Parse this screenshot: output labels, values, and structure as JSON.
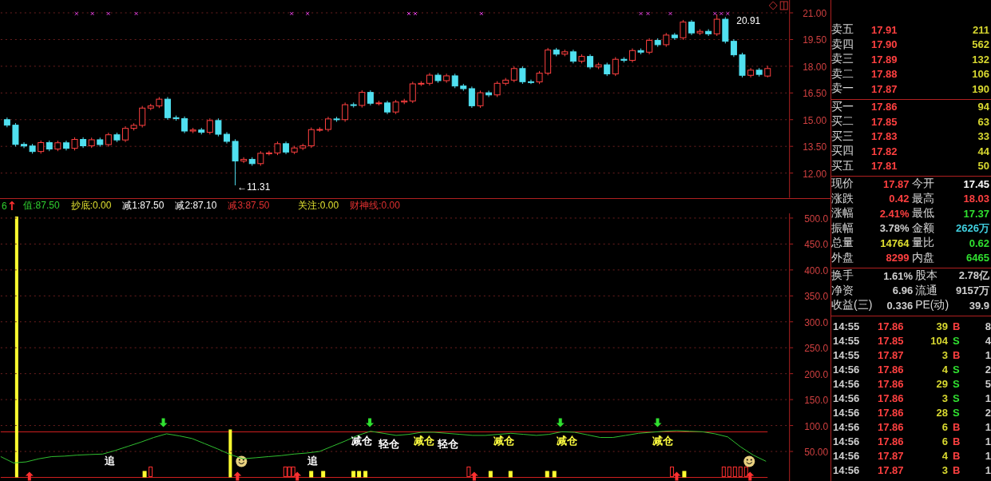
{
  "price_chart": {
    "high_label": "20.91",
    "low_label": "←11.31",
    "chart_data": {
      "type": "candlestick",
      "grid": true,
      "ylim": [
        10.61,
        21.72
      ],
      "yticks": [
        {
          "value": 21,
          "label": "21.00"
        },
        {
          "value": 19.5,
          "label": "19.50"
        },
        {
          "value": 18,
          "label": "18.00"
        },
        {
          "value": 16.5,
          "label": "16.50"
        },
        {
          "value": 15,
          "label": "15.00"
        },
        {
          "value": 13.5,
          "label": "13.50"
        },
        {
          "value": 12,
          "label": "12.00"
        }
      ],
      "ohlc": [
        [
          15.0,
          15.12,
          14.57,
          14.69
        ],
        [
          14.69,
          14.81,
          13.49,
          13.61
        ],
        [
          13.61,
          13.73,
          13.4,
          13.52
        ],
        [
          13.52,
          13.64,
          13.09,
          13.21
        ],
        [
          13.21,
          13.83,
          13.09,
          13.71
        ],
        [
          13.71,
          13.83,
          13.23,
          13.35
        ],
        [
          13.35,
          13.82,
          13.23,
          13.7
        ],
        [
          13.7,
          13.82,
          13.27,
          13.39
        ],
        [
          13.39,
          14.01,
          13.27,
          13.89
        ],
        [
          13.89,
          14.01,
          13.41,
          13.53
        ],
        [
          13.53,
          13.99,
          13.41,
          13.87
        ],
        [
          13.87,
          13.99,
          13.48,
          13.6
        ],
        [
          13.6,
          14.27,
          13.48,
          14.15
        ],
        [
          14.15,
          14.27,
          13.74,
          13.86
        ],
        [
          13.86,
          14.63,
          13.74,
          14.51
        ],
        [
          14.51,
          14.8,
          14.39,
          14.68
        ],
        [
          14.68,
          15.77,
          14.56,
          15.65
        ],
        [
          15.65,
          15.89,
          15.53,
          15.77
        ],
        [
          15.77,
          16.27,
          15.65,
          16.15
        ],
        [
          16.15,
          16.27,
          14.99,
          15.11
        ],
        [
          15.11,
          15.23,
          14.94,
          15.06
        ],
        [
          15.06,
          15.18,
          14.24,
          14.36
        ],
        [
          14.36,
          14.54,
          14.24,
          14.42
        ],
        [
          14.42,
          14.54,
          14.17,
          14.29
        ],
        [
          14.29,
          15.07,
          14.17,
          14.95
        ],
        [
          14.95,
          15.07,
          14.06,
          14.18
        ],
        [
          14.18,
          14.3,
          13.66,
          13.78
        ],
        [
          13.78,
          13.9,
          11.31,
          12.68
        ],
        [
          12.68,
          12.89,
          12.56,
          12.77
        ],
        [
          12.77,
          12.89,
          12.41,
          12.53
        ],
        [
          12.53,
          13.23,
          12.41,
          13.11
        ],
        [
          13.11,
          13.25,
          12.99,
          13.13
        ],
        [
          13.13,
          13.77,
          13.01,
          13.65
        ],
        [
          13.65,
          13.77,
          13.06,
          13.18
        ],
        [
          13.18,
          13.53,
          13.06,
          13.41
        ],
        [
          13.41,
          13.65,
          13.29,
          13.53
        ],
        [
          13.53,
          14.56,
          13.41,
          14.44
        ],
        [
          14.44,
          14.57,
          14.32,
          14.45
        ],
        [
          14.45,
          15.16,
          14.33,
          15.04
        ],
        [
          15.04,
          15.16,
          14.88,
          15.0
        ],
        [
          15.0,
          15.96,
          14.88,
          15.84
        ],
        [
          15.84,
          15.96,
          15.68,
          15.8
        ],
        [
          15.8,
          16.65,
          15.68,
          16.53
        ],
        [
          16.53,
          16.65,
          15.8,
          15.92
        ],
        [
          15.92,
          16.06,
          15.8,
          15.94
        ],
        [
          15.94,
          16.06,
          15.31,
          15.43
        ],
        [
          15.43,
          16.11,
          15.31,
          15.99
        ],
        [
          15.99,
          16.17,
          15.87,
          16.05
        ],
        [
          16.05,
          17.13,
          15.93,
          17.01
        ],
        [
          17.01,
          17.16,
          16.89,
          17.04
        ],
        [
          17.04,
          17.62,
          16.92,
          17.5
        ],
        [
          17.5,
          17.62,
          17.07,
          17.19
        ],
        [
          17.19,
          17.58,
          17.07,
          17.46
        ],
        [
          17.46,
          17.58,
          16.77,
          16.89
        ],
        [
          16.89,
          17.01,
          16.62,
          16.74
        ],
        [
          16.74,
          16.86,
          15.66,
          15.78
        ],
        [
          15.78,
          16.63,
          15.66,
          16.51
        ],
        [
          16.51,
          16.63,
          16.27,
          16.39
        ],
        [
          16.39,
          17.16,
          16.27,
          17.04
        ],
        [
          17.04,
          17.34,
          16.92,
          17.22
        ],
        [
          17.22,
          17.99,
          17.1,
          17.87
        ],
        [
          17.87,
          17.99,
          17.01,
          17.13
        ],
        [
          17.13,
          17.25,
          17.0,
          17.12
        ],
        [
          17.12,
          17.73,
          17.0,
          17.61
        ],
        [
          17.61,
          19.03,
          17.49,
          18.91
        ],
        [
          18.91,
          19.03,
          18.56,
          18.68
        ],
        [
          18.68,
          18.93,
          18.56,
          18.81
        ],
        [
          18.81,
          18.93,
          18.16,
          18.28
        ],
        [
          18.28,
          18.67,
          18.16,
          18.55
        ],
        [
          18.55,
          18.67,
          17.84,
          17.96
        ],
        [
          17.96,
          18.2,
          17.84,
          18.08
        ],
        [
          18.08,
          18.2,
          17.45,
          17.57
        ],
        [
          17.57,
          18.51,
          17.45,
          18.39
        ],
        [
          18.39,
          18.51,
          18.21,
          18.33
        ],
        [
          18.33,
          19.0,
          18.21,
          18.88
        ],
        [
          18.88,
          19.0,
          18.67,
          18.79
        ],
        [
          18.79,
          19.57,
          18.67,
          19.45
        ],
        [
          19.45,
          19.57,
          19.09,
          19.21
        ],
        [
          19.21,
          19.87,
          19.09,
          19.75
        ],
        [
          19.75,
          19.87,
          19.48,
          19.6
        ],
        [
          19.6,
          20.6,
          19.48,
          20.48
        ],
        [
          20.48,
          20.6,
          19.75,
          19.87
        ],
        [
          19.87,
          20.08,
          19.75,
          19.96
        ],
        [
          19.96,
          20.08,
          19.7,
          19.82
        ],
        [
          19.82,
          20.91,
          19.7,
          20.64
        ],
        [
          20.64,
          20.76,
          19.28,
          19.4
        ],
        [
          19.4,
          19.52,
          18.52,
          18.64
        ],
        [
          18.64,
          18.76,
          17.37,
          17.49
        ],
        [
          17.49,
          17.9,
          17.37,
          17.78
        ],
        [
          17.78,
          17.9,
          17.42,
          17.54
        ],
        [
          17.45,
          18.03,
          17.37,
          17.87
        ]
      ]
    }
  },
  "indicator": {
    "legend": [
      {
        "text": "6",
        "color": "#30d030"
      },
      {
        "text": "↑",
        "color": "#ff3030"
      },
      {
        "text": "值:87.50",
        "color": "#30d030"
      },
      {
        "text": "抄底:0.00",
        "color": "#e0e030"
      },
      {
        "text": "减1:87.50",
        "color": "#ffffff"
      },
      {
        "text": "减2:87.10",
        "color": "#ffffff"
      },
      {
        "text": "减3:87.50",
        "color": "#e03030"
      },
      {
        "text": "关注:0.00",
        "color": "#e0e030"
      },
      {
        "text": "财神线:0.00",
        "color": "#e03030"
      }
    ],
    "chart_data": {
      "type": "line",
      "grid": true,
      "ylim": [
        -7.6,
        503
      ],
      "yticks": [
        {
          "value": 500,
          "label": "500.0"
        },
        {
          "value": 450,
          "label": "450.0"
        },
        {
          "value": 400,
          "label": "400.0"
        },
        {
          "value": 350,
          "label": "350.0"
        },
        {
          "value": 300,
          "label": "300.0"
        },
        {
          "value": 250,
          "label": "250.0"
        },
        {
          "value": 200,
          "label": "200.0"
        },
        {
          "value": 150,
          "label": "150.0"
        },
        {
          "value": 100,
          "label": "100.0"
        },
        {
          "value": 50,
          "label": "50.00"
        }
      ],
      "series": [
        {
          "color": "#30c030",
          "values": [
            40,
            28,
            30,
            36,
            40,
            41,
            43,
            44,
            45,
            52,
            60,
            68,
            77,
            84,
            80,
            75,
            65,
            55,
            44,
            36,
            38,
            40,
            42,
            45,
            47,
            50,
            60,
            70,
            81,
            89,
            85,
            81,
            83,
            87,
            87,
            85,
            83,
            81,
            81,
            83,
            85,
            83,
            81,
            83,
            88,
            87,
            82,
            77,
            77,
            81,
            85,
            87,
            89,
            90,
            89,
            88,
            84,
            78,
            59,
            43,
            31
          ]
        }
      ]
    },
    "annotations": [
      {
        "text": "追",
        "color": "#ffffff"
      },
      {
        "text": "追",
        "color": "#ffffff"
      },
      {
        "text": "减仓",
        "color": "#ffffff"
      },
      {
        "text": "轻仓",
        "color": "#ffffff"
      },
      {
        "text": "减仓",
        "color": "#ffff40"
      },
      {
        "text": "轻仓",
        "color": "#ffffff"
      },
      {
        "text": "减仓",
        "color": "#ffff40"
      },
      {
        "text": "减仓",
        "color": "#ffff40"
      },
      {
        "text": "减仓",
        "color": "#ffff40"
      }
    ]
  },
  "order_book": {
    "asks": [
      {
        "label": "卖五",
        "price": "17.91",
        "volume": "211"
      },
      {
        "label": "卖四",
        "price": "17.90",
        "volume": "562"
      },
      {
        "label": "卖三",
        "price": "17.89",
        "volume": "132"
      },
      {
        "label": "卖二",
        "price": "17.88",
        "volume": "106"
      },
      {
        "label": "卖一",
        "price": "17.87",
        "volume": "190"
      }
    ],
    "bids": [
      {
        "label": "买一",
        "price": "17.86",
        "volume": "94"
      },
      {
        "label": "买二",
        "price": "17.85",
        "volume": "63"
      },
      {
        "label": "买三",
        "price": "17.83",
        "volume": "33"
      },
      {
        "label": "买四",
        "price": "17.82",
        "volume": "44"
      },
      {
        "label": "买五",
        "price": "17.81",
        "volume": "50"
      }
    ]
  },
  "quote": [
    {
      "label": "现价",
      "value": "17.87",
      "color": "#ff4040"
    },
    {
      "label": "今开",
      "value": "17.45",
      "color": "#ffffff"
    },
    {
      "label": "涨跌",
      "value": "0.42",
      "color": "#ff4040"
    },
    {
      "label": "最高",
      "value": "18.03",
      "color": "#ff4040"
    },
    {
      "label": "涨幅",
      "value": "2.41%",
      "color": "#ff4040"
    },
    {
      "label": "最低",
      "value": "17.37",
      "color": "#30e030"
    },
    {
      "label": "振幅",
      "value": "3.78%",
      "color": "#d0d0d0"
    },
    {
      "label": "金额",
      "value": "2626万",
      "color": "#40d0e0"
    },
    {
      "label": "总量",
      "value": "14764",
      "color": "#e0e030"
    },
    {
      "label": "量比",
      "value": "0.62",
      "color": "#30e030"
    },
    {
      "label": "外盘",
      "value": "8299",
      "color": "#ff4040"
    },
    {
      "label": "内盘",
      "value": "6465",
      "color": "#30e030"
    }
  ],
  "fundamentals": [
    {
      "label": "换手",
      "value": "1.61%"
    },
    {
      "label": "股本",
      "value": "2.78亿"
    },
    {
      "label": "净资",
      "value": "6.96"
    },
    {
      "label": "流通",
      "value": "9157万"
    },
    {
      "label": "收益(三)",
      "value": "0.336"
    },
    {
      "label": "PE(动)",
      "value": "39.9"
    }
  ],
  "trades": [
    {
      "time": "14:55",
      "price": "17.86",
      "volume": "39",
      "side": "B",
      "kind": "buy",
      "count": "8"
    },
    {
      "time": "14:55",
      "price": "17.85",
      "volume": "104",
      "side": "S",
      "kind": "sell",
      "count": "4"
    },
    {
      "time": "14:55",
      "price": "17.87",
      "volume": "3",
      "side": "B",
      "kind": "buy",
      "count": "1"
    },
    {
      "time": "14:56",
      "price": "17.86",
      "volume": "4",
      "side": "S",
      "kind": "sell",
      "count": "2"
    },
    {
      "time": "14:56",
      "price": "17.86",
      "volume": "29",
      "side": "S",
      "kind": "sell",
      "count": "5"
    },
    {
      "time": "14:56",
      "price": "17.86",
      "volume": "3",
      "side": "S",
      "kind": "sell",
      "count": "1"
    },
    {
      "time": "14:56",
      "price": "17.86",
      "volume": "28",
      "side": "S",
      "kind": "sell",
      "count": "2"
    },
    {
      "time": "14:56",
      "price": "17.86",
      "volume": "6",
      "side": "B",
      "kind": "buy",
      "count": "1"
    },
    {
      "time": "14:56",
      "price": "17.86",
      "volume": "6",
      "side": "B",
      "kind": "buy",
      "count": "1"
    },
    {
      "time": "14:56",
      "price": "17.87",
      "volume": "4",
      "side": "B",
      "kind": "buy",
      "count": "1"
    },
    {
      "time": "14:56",
      "price": "17.87",
      "volume": "3",
      "side": "B",
      "kind": "buy",
      "count": "1"
    }
  ]
}
